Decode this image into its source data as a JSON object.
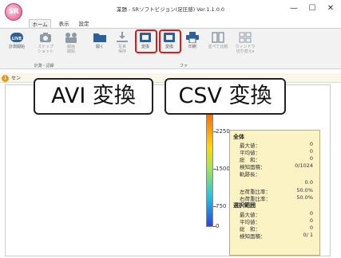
{
  "window": {
    "title": "業題 - SRソフトビジョン(足圧感) Ver.1.1.0.0",
    "app_icon": "SR",
    "controls": [
      "—",
      "☐",
      "✕"
    ]
  },
  "tabs": [
    "ホーム",
    "表示",
    "設定"
  ],
  "ribbon": {
    "buttons": [
      {
        "label": "計測開始",
        "icon": "live-icon"
      },
      {
        "label": "スナップ\nショット",
        "icon": "camera-icon"
      },
      {
        "label": "録画\n開始",
        "icon": "record-icon"
      },
      {
        "label": "開く",
        "icon": "folder-icon"
      },
      {
        "label": "写真\n保存",
        "icon": "download-icon"
      },
      {
        "label": "変換",
        "icon": "avi-convert-icon"
      },
      {
        "label": "変換",
        "icon": "csv-convert-icon"
      },
      {
        "label": "印刷",
        "icon": "printer-icon"
      },
      {
        "label": "並べて比較",
        "icon": "compare-icon"
      },
      {
        "label": "ウィンドウ\n切り替え▾",
        "icon": "window-switch-icon"
      }
    ],
    "groups": [
      "計測・記録",
      "ファ"
    ]
  },
  "infobar": {
    "text": "セン"
  },
  "colorbar": {
    "ticks": [
      "2250",
      "1500",
      "750",
      "0"
    ],
    "colors": [
      "#ff5a00",
      "#ffd800",
      "#a6e64c",
      "#21c4e4",
      "#2a42e8"
    ]
  },
  "stats": {
    "header_all": "全体",
    "rows_all": [
      {
        "label": "最大値：",
        "value": "0"
      },
      {
        "label": "平均値：",
        "value": "0"
      },
      {
        "label": "総　和：",
        "value": "0"
      },
      {
        "label": "検知面積：",
        "value": "0/1024"
      },
      {
        "label": "軌跡長：",
        "value": "0.0"
      },
      {
        "label": "左荷重比率：",
        "value": "50.0%"
      },
      {
        "label": "右荷重比率：",
        "value": "50.0%"
      }
    ],
    "header_sel": "選択範囲",
    "rows_sel": [
      {
        "label": "最大値：",
        "value": "0"
      },
      {
        "label": "平均値：",
        "value": "0"
      },
      {
        "label": "総　和：",
        "value": "0"
      },
      {
        "label": "検知面積：",
        "value": "0/ 1"
      }
    ]
  },
  "callouts": {
    "avi": "AVI 変換",
    "csv": "CSV 変換"
  },
  "accent_colors": {
    "highlight": "#e01818",
    "brand": "#e0507f",
    "ribbon_icon": "#2d5f9a"
  }
}
